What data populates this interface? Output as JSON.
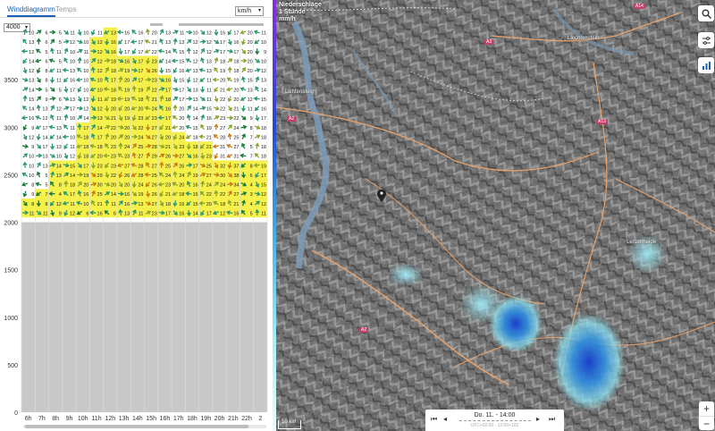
{
  "tabs": [
    {
      "label": "Winddiagramm",
      "active": true
    },
    {
      "label": "Temps",
      "active": false
    }
  ],
  "unit_select": {
    "value": "km/h"
  },
  "altitude_select": {
    "value": "4000"
  },
  "chart_data": {
    "type": "table",
    "title": "Winddiagramm",
    "xlabel": "",
    "ylabel": "",
    "x_ticks": [
      "6h",
      "7h",
      "8h",
      "9h",
      "10h",
      "11h",
      "12h",
      "13h",
      "14h",
      "15h",
      "16h",
      "17h",
      "18h",
      "19h",
      "20h",
      "21h",
      "22h",
      "2"
    ],
    "y_ticks": [
      0,
      500,
      1000,
      1500,
      2000,
      2500,
      3000,
      3500
    ],
    "ylim": [
      0,
      4000
    ],
    "terrain_top_m": 2000,
    "wind_levels_m": [
      2100,
      2200,
      2300,
      2400,
      2500,
      2600,
      2700,
      2800,
      2900,
      3000,
      3100,
      3200,
      3300,
      3400,
      3500,
      3600,
      3700,
      3800,
      3900,
      4000
    ],
    "wind_speed_kmh": [
      [
        11,
        8,
        9,
        8,
        10,
        10,
        10,
        9,
        12,
        9,
        16,
        14,
        15,
        14,
        13,
        12,
        14,
        12,
        13,
        10
      ],
      [
        11,
        8,
        7,
        5,
        5,
        13,
        13,
        17,
        14,
        17,
        12,
        13,
        9,
        5,
        8,
        8,
        6,
        5,
        6,
        6
      ],
      [
        9,
        12,
        4,
        8,
        13,
        14,
        10,
        13,
        14,
        13,
        11,
        12,
        6,
        5,
        11,
        11,
        5,
        11,
        5,
        5
      ],
      [
        12,
        11,
        17,
        18,
        14,
        15,
        12,
        11,
        10,
        11,
        10,
        17,
        13,
        17,
        16,
        13,
        10,
        10,
        12,
        11
      ],
      [
        6,
        10,
        16,
        20,
        19,
        17,
        18,
        18,
        18,
        17,
        14,
        12,
        12,
        10,
        10,
        10,
        10,
        11,
        10,
        10
      ],
      [
        16,
        21,
        25,
        30,
        29,
        23,
        20,
        18,
        17,
        14,
        13,
        12,
        11,
        10,
        10,
        12,
        12,
        12,
        12,
        11
      ],
      [
        6,
        11,
        14,
        20,
        22,
        23,
        23,
        23,
        20,
        22,
        21,
        20,
        19,
        18,
        17,
        18,
        18,
        16,
        16,
        13
      ],
      [
        13,
        16,
        16,
        20,
        26,
        27,
        23,
        24,
        20,
        20,
        19,
        20,
        19,
        19,
        20,
        19,
        16,
        17,
        17,
        16
      ],
      [
        11,
        13,
        19,
        24,
        28,
        28,
        27,
        25,
        24,
        22,
        23,
        20,
        18,
        19,
        17,
        17,
        17,
        17,
        17,
        16
      ],
      [
        23,
        27,
        26,
        26,
        25,
        27,
        29,
        28,
        27,
        27,
        23,
        24,
        21,
        22,
        23,
        26,
        23,
        22,
        21,
        20
      ],
      [
        17,
        18,
        21,
        23,
        24,
        25,
        26,
        21,
        20,
        21,
        17,
        16,
        18,
        17,
        16,
        15,
        14,
        14,
        13,
        13
      ],
      [
        16,
        16,
        18,
        20,
        24,
        26,
        27,
        23,
        24,
        20,
        20,
        20,
        17,
        17,
        15,
        16,
        15,
        15,
        13,
        11
      ],
      [
        14,
        15,
        15,
        16,
        19,
        17,
        16,
        18,
        18,
        15,
        14,
        14,
        13,
        13,
        12,
        13,
        12,
        12,
        12,
        10
      ],
      [
        17,
        20,
        22,
        24,
        27,
        25,
        23,
        21,
        21,
        19,
        16,
        15,
        11,
        11,
        11,
        13,
        13,
        12,
        12,
        12
      ],
      [
        12,
        18,
        22,
        24,
        30,
        32,
        31,
        31,
        28,
        27,
        23,
        22,
        22,
        21,
        20,
        19,
        18,
        17,
        17,
        16
      ],
      [
        16,
        21,
        27,
        34,
        38,
        37,
        31,
        27,
        25,
        24,
        22,
        21,
        20,
        20,
        19,
        18,
        18,
        17,
        16,
        17
      ],
      [
        5,
        4,
        3,
        4,
        6,
        8,
        7,
        5,
        7,
        8,
        9,
        11,
        12,
        13,
        15,
        20,
        20,
        20,
        20,
        20
      ],
      [
        11,
        12,
        12,
        15,
        17,
        19,
        18,
        18,
        18,
        18,
        17,
        16,
        15,
        14,
        13,
        12,
        10,
        9,
        10,
        11
      ]
    ],
    "highlight_windows": [
      {
        "col": 0,
        "from_m": 2100,
        "to_m": 2200
      },
      {
        "col": 1,
        "from_m": 2100,
        "to_m": 2300
      },
      {
        "col": 2,
        "from_m": 2100,
        "to_m": 2600
      },
      {
        "col": 3,
        "from_m": 2100,
        "to_m": 2600
      },
      {
        "col": 4,
        "from_m": 2100,
        "to_m": 3000
      },
      {
        "col": 5,
        "from_m": 2100,
        "to_m": 3900
      },
      {
        "col": 6,
        "from_m": 2100,
        "to_m": 4000
      },
      {
        "col": 7,
        "from_m": 2100,
        "to_m": 3700
      },
      {
        "col": 8,
        "from_m": 2100,
        "to_m": 3700
      },
      {
        "col": 9,
        "from_m": 2100,
        "to_m": 3700
      },
      {
        "col": 10,
        "from_m": 2100,
        "to_m": 3500
      },
      {
        "col": 11,
        "from_m": 2100,
        "to_m": 2900
      },
      {
        "col": 12,
        "from_m": 2100,
        "to_m": 2800
      },
      {
        "col": 13,
        "from_m": 2100,
        "to_m": 2800
      },
      {
        "col": 14,
        "from_m": 2100,
        "to_m": 2600
      },
      {
        "col": 15,
        "from_m": 2100,
        "to_m": 2600
      },
      {
        "col": 16,
        "from_m": 2100,
        "to_m": 2600
      },
      {
        "col": 17,
        "from_m": 2100,
        "to_m": 2600
      }
    ]
  },
  "map": {
    "layer_title": [
      "Niederschläge",
      "1 Stunde",
      "mm/h"
    ],
    "time_label": "Do. 11. - 14:00",
    "time_sub": "UTC+02:00 - 12:00+182",
    "scale_label": "10 km",
    "zoom_in": "+",
    "zoom_out": "−",
    "cities": [
      {
        "name": "Lenzerheide",
        "pos": "a"
      },
      {
        "name": "Liechtenstein",
        "pos": "b"
      },
      {
        "name": "Lichtensteig",
        "pos": "c"
      }
    ],
    "roads": [
      {
        "label": "A2",
        "type": "red"
      },
      {
        "label": "A3",
        "type": "red"
      },
      {
        "label": "A13",
        "type": "red"
      },
      {
        "label": "A14",
        "type": "red"
      },
      {
        "label": "A2",
        "type": "red"
      }
    ],
    "colors": {
      "accent": "#1a5fb4",
      "highlight": "#f5f04a",
      "terrain": "#c8c8c8",
      "precip_light": "#7fe0f5",
      "precip_heavy": "#1f4bd1"
    }
  },
  "controls": {
    "search_icon": "search-icon",
    "layers_icon": "sliders-icon",
    "chart_icon": "bar-chart-icon"
  }
}
